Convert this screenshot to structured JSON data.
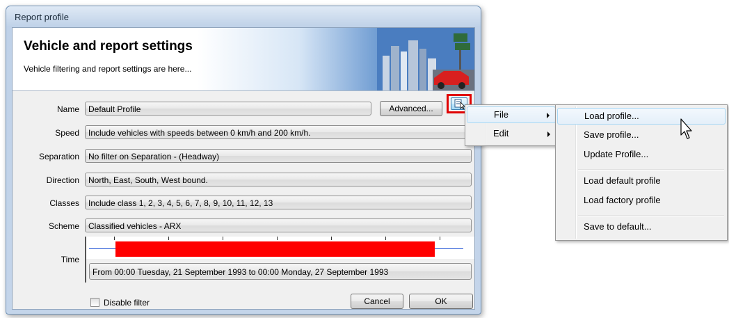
{
  "window": {
    "title": "Report profile"
  },
  "header": {
    "title": "Vehicle and report settings",
    "subtitle": "Vehicle filtering and report settings are here..."
  },
  "form": {
    "name": {
      "label": "Name",
      "value": "Default Profile"
    },
    "speed": {
      "label": "Speed",
      "value": "Include vehicles with speeds between 0 km/h and 200 km/h."
    },
    "separation": {
      "label": "Separation",
      "value": "No filter on Separation - (Headway)"
    },
    "direction": {
      "label": "Direction",
      "value": "North, East, South, West bound."
    },
    "classes": {
      "label": "Classes",
      "value": "Include class  1, 2, 3, 4, 5, 6, 7, 8, 9, 10, 11, 12, 13"
    },
    "scheme": {
      "label": "Scheme",
      "value": "Classified vehicles - ARX"
    },
    "time": {
      "label": "Time",
      "value": "From 00:00 Tuesday, 21 September 1993 to 00:00 Monday, 27 September 1993",
      "selection_start_fraction": 0.07,
      "selection_end_fraction": 0.92
    }
  },
  "buttons": {
    "advanced": "Advanced...",
    "cancel": "Cancel",
    "ok": "OK",
    "profile_menu_icon": "profile-menu-icon"
  },
  "options": {
    "disable_filter": "Disable filter",
    "disable_filter_checked": false
  },
  "context_menu": {
    "items": [
      {
        "label": "File",
        "has_submenu": true,
        "highlighted": true
      },
      {
        "label": "Edit",
        "has_submenu": true,
        "highlighted": false
      }
    ]
  },
  "file_submenu": {
    "items": [
      {
        "label": "Load profile...",
        "highlighted": true
      },
      {
        "label": "Save profile..."
      },
      {
        "label": "Update Profile..."
      },
      {
        "label": "Load default profile"
      },
      {
        "label": "Load factory profile"
      },
      {
        "label": "Save to default..."
      }
    ]
  },
  "colors": {
    "selection_bar": "#ff0000",
    "highlight_frame": "#e00000",
    "timeline_axis": "#2a5bd7"
  }
}
